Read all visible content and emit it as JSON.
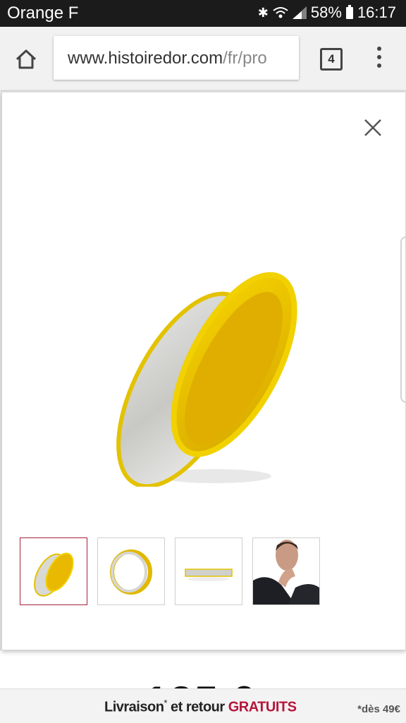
{
  "status_bar": {
    "carrier": "Orange F",
    "battery": "58%",
    "time": "16:17"
  },
  "browser": {
    "url_domain": "www.histoiredor.com",
    "url_path": "/fr/pro",
    "tab_count": "4",
    "icons": [
      "home-icon",
      "tab-switcher-icon",
      "overflow-menu-icon"
    ]
  },
  "gallery": {
    "close_icon": "close-icon",
    "main_image": "two-tone gold wedding band",
    "thumbnails": [
      "ring-angle-view",
      "ring-front-view",
      "ring-side-view",
      "ring-worn-on-hand"
    ],
    "selected_index": 0,
    "accent_color": "#a3223a"
  },
  "page": {
    "price_partial": "125,0"
  },
  "banner": {
    "text_prefix": "Livraison",
    "asterisk": "*",
    "text_middle": " et retour ",
    "text_highlight": "GRATUITS",
    "note": "*dès 49€",
    "highlight_color": "#b5163b"
  }
}
